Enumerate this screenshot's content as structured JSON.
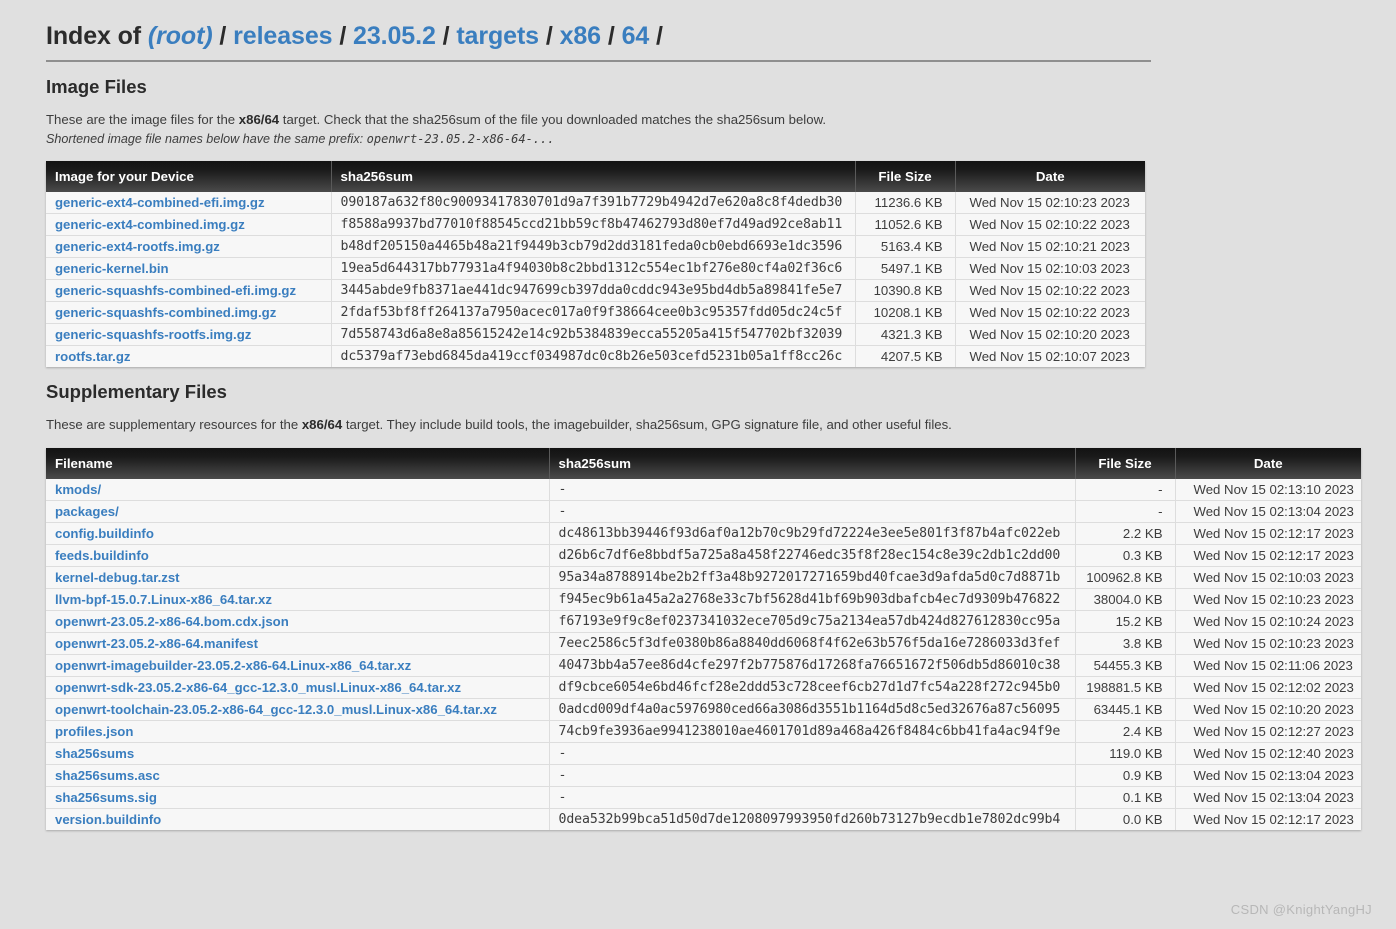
{
  "header": {
    "prefix": "Index of",
    "crumbs": [
      {
        "label": "(root)",
        "italic": true
      },
      {
        "label": "releases",
        "italic": false
      },
      {
        "label": "23.05.2",
        "italic": false
      },
      {
        "label": "targets",
        "italic": false
      },
      {
        "label": "x86",
        "italic": false
      },
      {
        "label": "64",
        "italic": false
      }
    ],
    "separator": "/"
  },
  "image_section": {
    "title": "Image Files",
    "desc_part1": "These are the image files for the ",
    "desc_target": "x86/64",
    "desc_part2": " target. Check that the sha256sum of the file you downloaded matches the sha256sum below.",
    "note_text": "Shortened image file names below have the same prefix: ",
    "note_prefix": "openwrt-23.05.2-x86-64-...",
    "columns": [
      "Image for your Device",
      "sha256sum",
      "File Size",
      "Date"
    ],
    "rows": [
      {
        "name": "generic-ext4-combined-efi.img.gz",
        "hash": "090187a632f80c90093417830701d9a7f391b7729b4942d7e620a8c8f4dedb30",
        "size": "11236.6 KB",
        "date": "Wed Nov 15 02:10:23 2023"
      },
      {
        "name": "generic-ext4-combined.img.gz",
        "hash": "f8588a9937bd77010f88545ccd21bb59cf8b47462793d80ef7d49ad92ce8ab11",
        "size": "11052.6 KB",
        "date": "Wed Nov 15 02:10:22 2023"
      },
      {
        "name": "generic-ext4-rootfs.img.gz",
        "hash": "b48df205150a4465b48a21f9449b3cb79d2dd3181feda0cb0ebd6693e1dc3596",
        "size": "5163.4 KB",
        "date": "Wed Nov 15 02:10:21 2023"
      },
      {
        "name": "generic-kernel.bin",
        "hash": "19ea5d644317bb77931a4f94030b8c2bbd1312c554ec1bf276e80cf4a02f36c6",
        "size": "5497.1 KB",
        "date": "Wed Nov 15 02:10:03 2023"
      },
      {
        "name": "generic-squashfs-combined-efi.img.gz",
        "hash": "3445abde9fb8371ae441dc947699cb397dda0cddc943e95bd4db5a89841fe5e7",
        "size": "10390.8 KB",
        "date": "Wed Nov 15 02:10:22 2023"
      },
      {
        "name": "generic-squashfs-combined.img.gz",
        "hash": "2fdaf53bf8ff264137a7950acec017a0f9f38664cee0b3c95357fdd05dc24c5f",
        "size": "10208.1 KB",
        "date": "Wed Nov 15 02:10:22 2023"
      },
      {
        "name": "generic-squashfs-rootfs.img.gz",
        "hash": "7d558743d6a8e8a85615242e14c92b5384839ecca55205a415f547702bf32039",
        "size": "4321.3 KB",
        "date": "Wed Nov 15 02:10:20 2023"
      },
      {
        "name": "rootfs.tar.gz",
        "hash": "dc5379af73ebd6845da419ccf034987dc0c8b26e503cefd5231b05a1ff8cc26c",
        "size": "4207.5 KB",
        "date": "Wed Nov 15 02:10:07 2023"
      }
    ]
  },
  "supp_section": {
    "title": "Supplementary Files",
    "desc_part1": "These are supplementary resources for the ",
    "desc_target": "x86/64",
    "desc_part2": " target. They include build tools, the imagebuilder, sha256sum, GPG signature file, and other useful files.",
    "columns": [
      "Filename",
      "sha256sum",
      "File Size",
      "Date"
    ],
    "rows": [
      {
        "name": "kmods/",
        "hash": "-",
        "size": "-",
        "date": "Wed Nov 15 02:13:10 2023"
      },
      {
        "name": "packages/",
        "hash": "-",
        "size": "-",
        "date": "Wed Nov 15 02:13:04 2023"
      },
      {
        "name": "config.buildinfo",
        "hash": "dc48613bb39446f93d6af0a12b70c9b29fd72224e3ee5e801f3f87b4afc022eb",
        "size": "2.2 KB",
        "date": "Wed Nov 15 02:12:17 2023"
      },
      {
        "name": "feeds.buildinfo",
        "hash": "d26b6c7df6e8bbdf5a725a8a458f22746edc35f8f28ec154c8e39c2db1c2dd00",
        "size": "0.3 KB",
        "date": "Wed Nov 15 02:12:17 2023"
      },
      {
        "name": "kernel-debug.tar.zst",
        "hash": "95a34a8788914be2b2ff3a48b9272017271659bd40fcae3d9afda5d0c7d8871b",
        "size": "100962.8 KB",
        "date": "Wed Nov 15 02:10:03 2023"
      },
      {
        "name": "llvm-bpf-15.0.7.Linux-x86_64.tar.xz",
        "hash": "f945ec9b61a45a2a2768e33c7bf5628d41bf69b903dbafcb4ec7d9309b476822",
        "size": "38004.0 KB",
        "date": "Wed Nov 15 02:10:23 2023"
      },
      {
        "name": "openwrt-23.05.2-x86-64.bom.cdx.json",
        "hash": "f67193e9f9c8ef0237341032ece705d9c75a2134ea57db424d827612830cc95a",
        "size": "15.2 KB",
        "date": "Wed Nov 15 02:10:24 2023"
      },
      {
        "name": "openwrt-23.05.2-x86-64.manifest",
        "hash": "7eec2586c5f3dfe0380b86a8840dd6068f4f62e63b576f5da16e7286033d3fef",
        "size": "3.8 KB",
        "date": "Wed Nov 15 02:10:23 2023"
      },
      {
        "name": "openwrt-imagebuilder-23.05.2-x86-64.Linux-x86_64.tar.xz",
        "hash": "40473bb4a57ee86d4cfe297f2b775876d17268fa76651672f506db5d86010c38",
        "size": "54455.3 KB",
        "date": "Wed Nov 15 02:11:06 2023"
      },
      {
        "name": "openwrt-sdk-23.05.2-x86-64_gcc-12.3.0_musl.Linux-x86_64.tar.xz",
        "hash": "df9cbce6054e6bd46fcf28e2ddd53c728ceef6cb27d1d7fc54a228f272c945b0",
        "size": "198881.5 KB",
        "date": "Wed Nov 15 02:12:02 2023"
      },
      {
        "name": "openwrt-toolchain-23.05.2-x86-64_gcc-12.3.0_musl.Linux-x86_64.tar.xz",
        "hash": "0adcd009df4a0ac5976980ced66a3086d3551b1164d5d8c5ed32676a87c56095",
        "size": "63445.1 KB",
        "date": "Wed Nov 15 02:10:20 2023"
      },
      {
        "name": "profiles.json",
        "hash": "74cb9fe3936ae9941238010ae4601701d89a468a426f8484c6bb41fa4ac94f9e",
        "size": "2.4 KB",
        "date": "Wed Nov 15 02:12:27 2023"
      },
      {
        "name": "sha256sums",
        "hash": "-",
        "size": "119.0 KB",
        "date": "Wed Nov 15 02:12:40 2023"
      },
      {
        "name": "sha256sums.asc",
        "hash": "-",
        "size": "0.9 KB",
        "date": "Wed Nov 15 02:13:04 2023"
      },
      {
        "name": "sha256sums.sig",
        "hash": "-",
        "size": "0.1 KB",
        "date": "Wed Nov 15 02:13:04 2023"
      },
      {
        "name": "version.buildinfo",
        "hash": "0dea532b99bca51d50d7de1208097993950fd260b73127b9ecdb1e7802dc99b4",
        "size": "0.0 KB",
        "date": "Wed Nov 15 02:12:17 2023"
      }
    ]
  },
  "watermark": "CSDN @KnightYangHJ",
  "colors": {
    "link": "#3a7ebf",
    "background": "#e0e0e0",
    "table_row": "#f7f7f7",
    "header_dark": "#1b1b1b"
  }
}
